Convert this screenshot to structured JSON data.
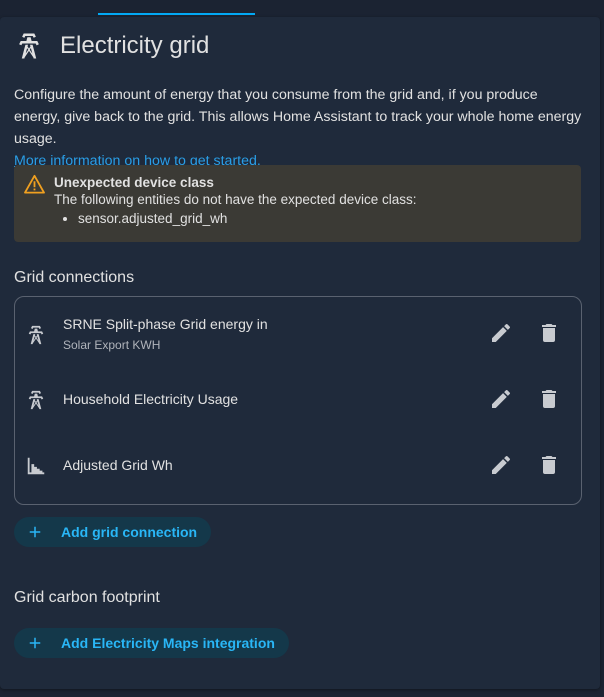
{
  "header": {
    "title": "Electricity grid",
    "icon": "transmission-tower-icon"
  },
  "description": {
    "text": "Configure the amount of energy that you consume from the grid and, if you produce energy, give back to the grid. This allows Home Assistant to track your whole home energy usage.",
    "link": "More information on how to get started."
  },
  "alert": {
    "title": "Unexpected device class",
    "body": "The following entities do not have the expected device class:",
    "entities": [
      "sensor.adjusted_grid_wh"
    ],
    "color": "#f0a020"
  },
  "grid_connections": {
    "title": "Grid connections",
    "items": [
      {
        "primary": "SRNE Split-phase Grid energy in",
        "secondary": "Solar Export KWH",
        "icon": "transmission-tower-icon"
      },
      {
        "primary": "Household Electricity Usage",
        "secondary": "",
        "icon": "transmission-tower-icon"
      },
      {
        "primary": "Adjusted Grid Wh",
        "secondary": "",
        "icon": "chart-bar-icon"
      }
    ],
    "add_label": "Add grid connection"
  },
  "carbon": {
    "title": "Grid carbon footprint",
    "add_label": "Add Electricity Maps integration"
  },
  "colors": {
    "accent": "#29b6f6",
    "link": "#2a9ee6",
    "background": "#1f2a3b"
  }
}
